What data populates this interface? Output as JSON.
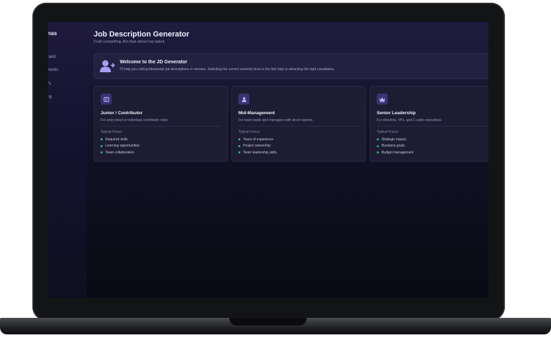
{
  "sidebar": {
    "brand": "ersonas",
    "items": [
      {
        "label": "hboard"
      },
      {
        "label": "cuments"
      },
      {
        "label": "Vs"
      },
      {
        "label": "ing"
      }
    ]
  },
  "header": {
    "title": "Job Description Generator",
    "subtitle": "Craft compelling JDs that attract top talent."
  },
  "welcome": {
    "title": "Welcome to the JD Generator",
    "text": "I'll help you craft professional job descriptions in minutes. Selecting the correct seniority level is the first step to attracting the right candidates."
  },
  "levels": [
    {
      "title": "Junior / Contributor",
      "description": "For entry-level or individual contributor roles.",
      "focus_label": "Typical Focus:",
      "focus": [
        "Required skills",
        "Learning opportunities",
        "Team collaboration"
      ],
      "icon": "id-badge-icon"
    },
    {
      "title": "Mid-Management",
      "description": "For team leads and managers with direct reports.",
      "focus_label": "Typical Focus:",
      "focus": [
        "Years of experience",
        "Project ownership",
        "Team leadership skills"
      ],
      "icon": "user-badge-icon"
    },
    {
      "title": "Senior Leadership",
      "description": "For directors, VPs, and C-suite executives.",
      "focus_label": "Typical Focus:",
      "focus": [
        "Strategic impact",
        "Business goals",
        "Budget management"
      ],
      "icon": "crown-icon"
    }
  ],
  "colors": {
    "accent": "#8b7cf6",
    "focus_dot": "#22c55e",
    "card_bg": "#1d1c33"
  }
}
